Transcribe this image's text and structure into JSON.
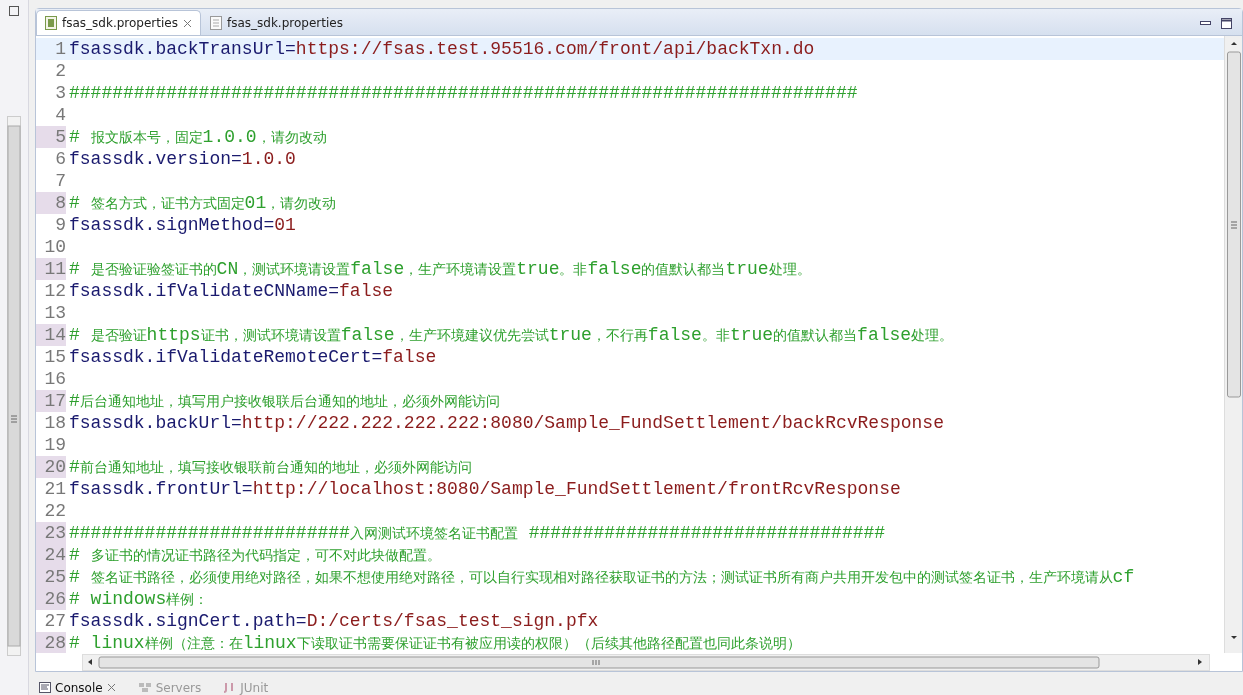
{
  "editor_tabs": [
    {
      "label": "fsas_sdk.properties",
      "kind": "properties",
      "selected": true,
      "closable": true
    },
    {
      "label": "fsas_sdk.properties",
      "kind": "text",
      "selected": false,
      "closable": false
    }
  ],
  "lines": [
    {
      "number": "1",
      "kind": "property",
      "key": "fsassdk.backTransUrl",
      "separator": "=",
      "value": "https://fsas.test.95516.com/front/api/backTxn.do",
      "marked": false,
      "current": true
    },
    {
      "number": "2",
      "kind": "blank",
      "marked": false,
      "current": false
    },
    {
      "number": "3",
      "kind": "comment",
      "text": "#########################################################################",
      "marked": false,
      "current": false
    },
    {
      "number": "4",
      "kind": "blank",
      "marked": false,
      "current": false
    },
    {
      "number": "5",
      "kind": "comment",
      "text": "#  报文版本号，固定1.0.0，请勿改动",
      "marked": true,
      "current": false
    },
    {
      "number": "6",
      "kind": "property",
      "key": "fsassdk.version",
      "separator": "=",
      "value": "1.0.0",
      "marked": false,
      "current": false
    },
    {
      "number": "7",
      "kind": "blank",
      "marked": false,
      "current": false
    },
    {
      "number": "8",
      "kind": "comment",
      "text": "#  签名方式，证书方式固定01，请勿改动",
      "marked": true,
      "current": false
    },
    {
      "number": "9",
      "kind": "property",
      "key": "fsassdk.signMethod",
      "separator": "=",
      "value": "01",
      "marked": false,
      "current": false
    },
    {
      "number": "10",
      "kind": "blank",
      "marked": false,
      "current": false
    },
    {
      "number": "11",
      "kind": "comment",
      "text": "#  是否验证验签证书的CN，测试环境请设置false，生产环境请设置true。非false的值默认都当true处理。",
      "marked": true,
      "current": false
    },
    {
      "number": "12",
      "kind": "property",
      "key": "fsassdk.ifValidateCNName",
      "separator": "=",
      "value": "false",
      "marked": false,
      "current": false
    },
    {
      "number": "13",
      "kind": "blank",
      "marked": false,
      "current": false
    },
    {
      "number": "14",
      "kind": "comment",
      "text": "#  是否验证https证书，测试环境请设置false，生产环境建议优先尝试true，不行再false。非true的值默认都当false处理。",
      "marked": true,
      "current": false
    },
    {
      "number": "15",
      "kind": "property",
      "key": "fsassdk.ifValidateRemoteCert",
      "separator": "=",
      "value": "false",
      "marked": false,
      "current": false
    },
    {
      "number": "16",
      "kind": "blank",
      "marked": false,
      "current": false
    },
    {
      "number": "17",
      "kind": "comment",
      "text": "#后台通知地址，填写用户接收银联后台通知的地址，必须外网能访问",
      "marked": true,
      "current": false
    },
    {
      "number": "18",
      "kind": "property",
      "key": "fsassdk.backUrl",
      "separator": "=",
      "value": "http://222.222.222.222:8080/Sample_FundSettlement/backRcvResponse",
      "marked": false,
      "current": false
    },
    {
      "number": "19",
      "kind": "blank",
      "marked": false,
      "current": false
    },
    {
      "number": "20",
      "kind": "comment",
      "text": "#前台通知地址，填写接收银联前台通知的地址，必须外网能访问",
      "marked": true,
      "current": false
    },
    {
      "number": "21",
      "kind": "property",
      "key": "fsassdk.frontUrl",
      "separator": "=",
      "value": "http://localhost:8080/Sample_FundSettlement/frontRcvResponse",
      "marked": false,
      "current": false
    },
    {
      "number": "22",
      "kind": "blank",
      "marked": false,
      "current": false
    },
    {
      "number": "23",
      "kind": "comment",
      "text": "##########################入网测试环境签名证书配置 #################################",
      "marked": true,
      "current": false
    },
    {
      "number": "24",
      "kind": "comment",
      "text": "#  多证书的情况证书路径为代码指定，可不对此块做配置。",
      "marked": true,
      "current": false
    },
    {
      "number": "25",
      "kind": "comment",
      "text": "#  签名证书路径，必须使用绝对路径，如果不想使用绝对路径，可以自行实现相对路径获取证书的方法；测试证书所有商户共用开发包中的测试签名证书，生产环境请从cf",
      "marked": true,
      "current": false
    },
    {
      "number": "26",
      "kind": "comment",
      "text": "#  windows样例：",
      "marked": true,
      "current": false
    },
    {
      "number": "27",
      "kind": "property",
      "key": "fsassdk.signCert.path",
      "separator": "=",
      "value": "D:/certs/fsas_test_sign.pfx",
      "marked": false,
      "current": false
    },
    {
      "number": "28",
      "kind": "comment",
      "text": "#  linux样例（注意：在linux下读取证书需要保证证书有被应用读的权限）（后续其他路径配置也同此条说明）",
      "marked": true,
      "current": false
    }
  ],
  "bottom_tabs": [
    {
      "label": "Console",
      "kind": "console",
      "selected": true
    },
    {
      "label": "Servers",
      "kind": "servers",
      "selected": false
    },
    {
      "label": "JUnit",
      "kind": "junit",
      "selected": false
    }
  ]
}
